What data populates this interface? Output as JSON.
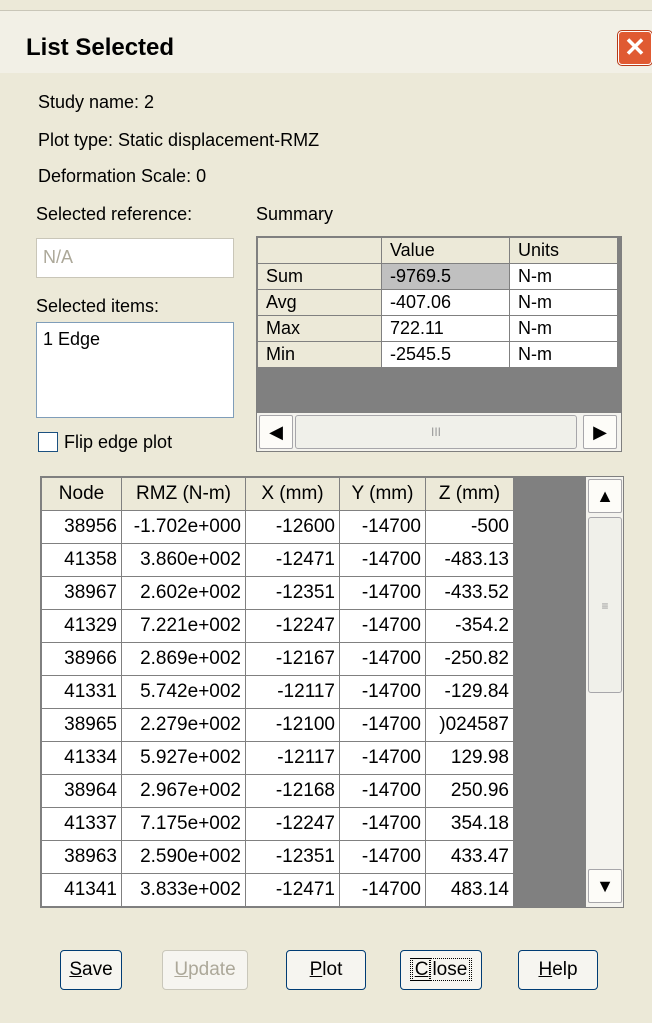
{
  "window": {
    "title": "List Selected"
  },
  "info": {
    "study_name": "Study name: 2",
    "plot_type": "Plot type: Static displacement-RMZ",
    "deformation_scale": "Deformation Scale: 0"
  },
  "selected_reference": {
    "label": "Selected reference:",
    "value": "N/A"
  },
  "selected_items": {
    "label": "Selected items:",
    "value": "1 Edge"
  },
  "flip_edge_plot": {
    "label": "Flip edge plot",
    "checked": false
  },
  "summary": {
    "label": "Summary",
    "headers": [
      "",
      "Value",
      "Units"
    ],
    "rows": [
      {
        "name": "Sum",
        "value": "-9769.5",
        "units": "N-m"
      },
      {
        "name": "Avg",
        "value": "-407.06",
        "units": "N-m"
      },
      {
        "name": "Max",
        "value": "722.11",
        "units": "N-m"
      },
      {
        "name": "Min",
        "value": "-2545.5",
        "units": "N-m"
      }
    ],
    "scroll_icons": {
      "left": "arrow-left-icon",
      "right": "arrow-right-icon",
      "grip": "III"
    }
  },
  "table": {
    "headers": [
      "Node",
      "RMZ (N-m)",
      "X (mm)",
      "Y (mm)",
      "Z (mm)"
    ],
    "rows": [
      [
        "38956",
        "-1.702e+000",
        "-12600",
        "-14700",
        "-500"
      ],
      [
        "41358",
        "3.860e+002",
        "-12471",
        "-14700",
        "-483.13"
      ],
      [
        "38967",
        "2.602e+002",
        "-12351",
        "-14700",
        "-433.52"
      ],
      [
        "41329",
        "7.221e+002",
        "-12247",
        "-14700",
        "-354.2"
      ],
      [
        "38966",
        "2.869e+002",
        "-12167",
        "-14700",
        "-250.82"
      ],
      [
        "41331",
        "5.742e+002",
        "-12117",
        "-14700",
        "-129.84"
      ],
      [
        "38965",
        "2.279e+002",
        "-12100",
        "-14700",
        ")024587"
      ],
      [
        "41334",
        "5.927e+002",
        "-12117",
        "-14700",
        "129.98"
      ],
      [
        "38964",
        "2.967e+002",
        "-12168",
        "-14700",
        "250.96"
      ],
      [
        "41337",
        "7.175e+002",
        "-12247",
        "-14700",
        "354.18"
      ],
      [
        "38963",
        "2.590e+002",
        "-12351",
        "-14700",
        "433.47"
      ],
      [
        "41341",
        "3.833e+002",
        "-12471",
        "-14700",
        "483.14"
      ]
    ]
  },
  "buttons": {
    "save": {
      "pre": "",
      "ul": "S",
      "post": "ave"
    },
    "update": {
      "pre": "",
      "ul": "U",
      "post": "pdate"
    },
    "plot": {
      "pre": "",
      "ul": "P",
      "post": "lot"
    },
    "close": {
      "pre": "",
      "ul": "C",
      "post": "lose"
    },
    "help": {
      "pre": "",
      "ul": "H",
      "post": "elp"
    }
  },
  "colors": {
    "accent_close": "#e05a32",
    "face": "#ece9d8"
  }
}
